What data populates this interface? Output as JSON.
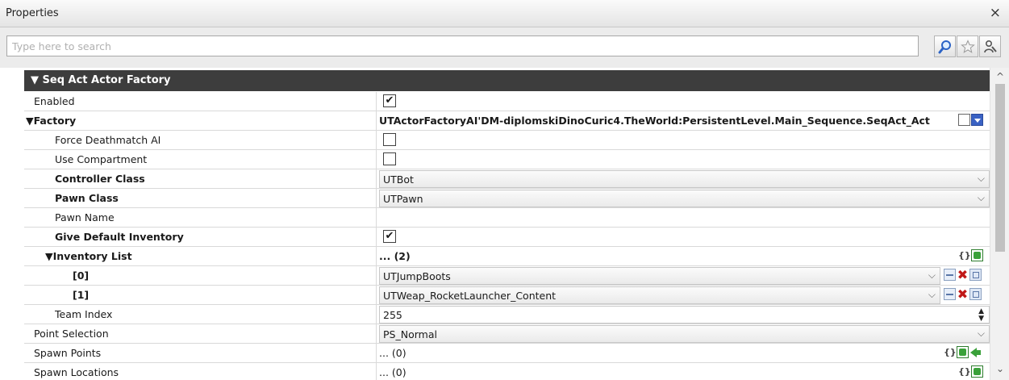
{
  "window": {
    "title": "Properties",
    "close_glyph": "×"
  },
  "search": {
    "placeholder": "Type here to search",
    "value": ""
  },
  "toolbar": {
    "icons": [
      "magnifier-icon",
      "star-icon",
      "wrench-person-icon"
    ]
  },
  "section": {
    "arrow": "▼",
    "label": "Seq Act Actor Factory"
  },
  "rows": {
    "enabled": {
      "label": "Enabled",
      "checked": "✔"
    },
    "factory": {
      "arrow": "▼",
      "label": "Factory",
      "value": "UTActorFactoryAI'DM-diplomskiDinoCuric4.TheWorld:PersistentLevel.Main_Sequence.SeqAct_Act"
    },
    "force_deathmatch_ai": {
      "label": "Force Deathmatch AI",
      "checked": ""
    },
    "use_compartment": {
      "label": "Use Compartment",
      "checked": ""
    },
    "controller_class": {
      "label": "Controller Class",
      "value": "UTBot"
    },
    "pawn_class": {
      "label": "Pawn Class",
      "value": "UTPawn"
    },
    "pawn_name": {
      "label": "Pawn Name",
      "value": ""
    },
    "give_default_inventory": {
      "label": "Give Default Inventory",
      "checked": "✔"
    },
    "inventory_list": {
      "arrow": "▼",
      "label": "Inventory List",
      "value": "... (2)"
    },
    "inventory_0": {
      "label": "[0]",
      "value": "UTJumpBoots"
    },
    "inventory_1": {
      "label": "[1]",
      "value": "UTWeap_RocketLauncher_Content"
    },
    "team_index": {
      "label": "Team Index",
      "value": "255"
    },
    "point_selection": {
      "label": "Point Selection",
      "value": "PS_Normal"
    },
    "spawn_points": {
      "label": "Spawn Points",
      "value": "... (0)"
    },
    "spawn_locations": {
      "label": "Spawn Locations",
      "value": "... (0)"
    }
  },
  "glyphs": {
    "dropdown": "⌵",
    "scroll_up": "^",
    "scroll_down": "⌄",
    "spin_up": "▲",
    "spin_down": "▼",
    "braces": "{}"
  },
  "colors": {
    "section_bg": "#3d3d3d",
    "delete_red": "#c01818",
    "add_green": "#3aa13a",
    "browse_blue": "#3a62c4"
  }
}
